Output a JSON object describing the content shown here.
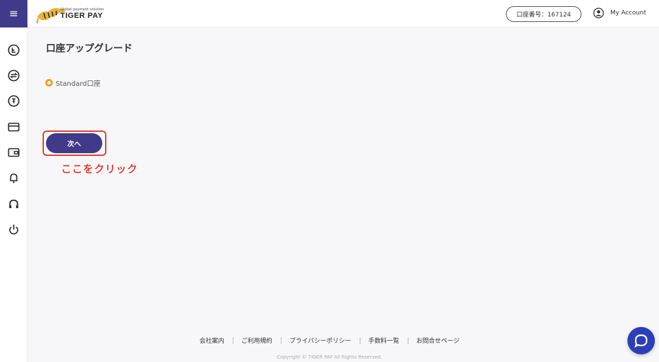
{
  "header": {
    "menu_icon": "hamburger-icon",
    "logo": {
      "subtitle": "Global payment solution",
      "name": "TIGER PAY"
    },
    "account_number": "口座番号：167124",
    "my_account_label": "My Account",
    "my_account_icon": "user-circle-icon"
  },
  "sidebar": {
    "items": [
      {
        "icon": "coin-icon"
      },
      {
        "icon": "exchange-icon"
      },
      {
        "icon": "withdraw-icon"
      },
      {
        "icon": "card-icon"
      },
      {
        "icon": "wallet-icon"
      },
      {
        "icon": "bell-icon"
      },
      {
        "icon": "headset-icon"
      },
      {
        "icon": "power-icon"
      }
    ]
  },
  "main": {
    "title": "口座アップグレード",
    "option_label": "Standard口座",
    "option_selected": true,
    "next_button_label": "次へ",
    "annotation": "ここをクリック"
  },
  "footer": {
    "links": [
      "会社案内",
      "ご利用規約",
      "プライバシーポリシー",
      "手数料一覧",
      "お問合せページ"
    ],
    "copyright": "Copyright © TIGER PAY All Rights Reserved."
  },
  "colors": {
    "brand": "#3f3a8a",
    "radio_accent": "#f0a020",
    "annotation": "#e0412f",
    "chat": "#2c3fb8"
  }
}
